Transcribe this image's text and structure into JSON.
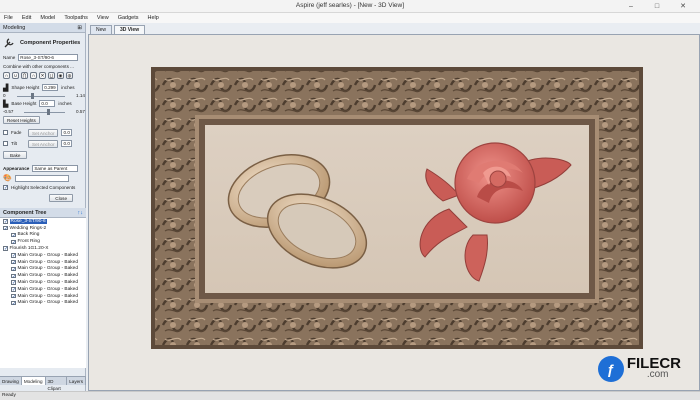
{
  "app": {
    "title": "Aspire (jeff searles) - [New - 3D View]",
    "win_ctrls": [
      "–",
      "□",
      "✕"
    ]
  },
  "menu": [
    "File",
    "Edit",
    "Model",
    "Toolpaths",
    "View",
    "Gadgets",
    "Help"
  ],
  "sidebar": {
    "panel_title": "Modeling",
    "comp_props_title": "Component Properties",
    "name_label": "Name",
    "name_value": "Rose_3-ST/90-6",
    "combine_label": "Combine with other components ...",
    "shape_height_label": "Shape Height",
    "shape_height_value": "0.299",
    "shape_height_unit": "inches",
    "shape_min": "0",
    "shape_max": "1.14",
    "base_height_label": "Base Height",
    "base_height_value": "0.0",
    "base_height_unit": "inches",
    "base_min": "-0.57",
    "base_max": "0.57",
    "reset_heights": "Reset Heights",
    "fade_label": "Fade",
    "tilt_label": "Tilt",
    "set_anchor": "Set Anchor",
    "fade_value": "0.0",
    "tilt_value": "0.0",
    "bake_label": "Bake",
    "appearance_label": "Appearance",
    "appearance_value": "Same as Parent",
    "highlight_label": "Highlight Selected Components",
    "close_label": "Close"
  },
  "tree": {
    "title": "Component Tree",
    "items": [
      {
        "label": "Rose_3-ST/90-6",
        "indent": 0,
        "selected": true
      },
      {
        "label": "Wedding Rings-2",
        "indent": 0,
        "selected": false
      },
      {
        "label": "Back Ring",
        "indent": 1,
        "selected": false
      },
      {
        "label": "Front Ring",
        "indent": 1,
        "selected": false
      },
      {
        "label": "Flourish 1G1.20-X",
        "indent": 0,
        "selected": false
      },
      {
        "label": "Main Group - Group - Baked",
        "indent": 1,
        "selected": false
      },
      {
        "label": "Main Group - Group - Baked",
        "indent": 1,
        "selected": false
      },
      {
        "label": "Main Group - Group - Baked",
        "indent": 1,
        "selected": false
      },
      {
        "label": "Main Group - Group - Baked",
        "indent": 1,
        "selected": false
      },
      {
        "label": "Main Group - Group - Baked",
        "indent": 1,
        "selected": false
      },
      {
        "label": "Main Group - Group - Baked",
        "indent": 1,
        "selected": false
      },
      {
        "label": "Main Group - Group - Baked",
        "indent": 1,
        "selected": false
      },
      {
        "label": "Main Group - Group - Baked",
        "indent": 1,
        "selected": false
      }
    ]
  },
  "bottom_tabs": [
    {
      "label": "Drawing",
      "active": false
    },
    {
      "label": "Modeling",
      "active": true
    },
    {
      "label": "3D Clipart",
      "active": false
    },
    {
      "label": "Layers",
      "active": false
    }
  ],
  "doc_tabs": [
    {
      "label": "New",
      "active": false
    },
    {
      "label": "3D View",
      "active": true
    }
  ],
  "status": "Ready",
  "watermark": {
    "letter": "ƒ",
    "name": "FILECR",
    "sub": ".com"
  },
  "colors": {
    "wood": "#c9a98a",
    "rose": "#d9706a",
    "frame": "#6f5a47",
    "selection": "#2b5fb8"
  }
}
